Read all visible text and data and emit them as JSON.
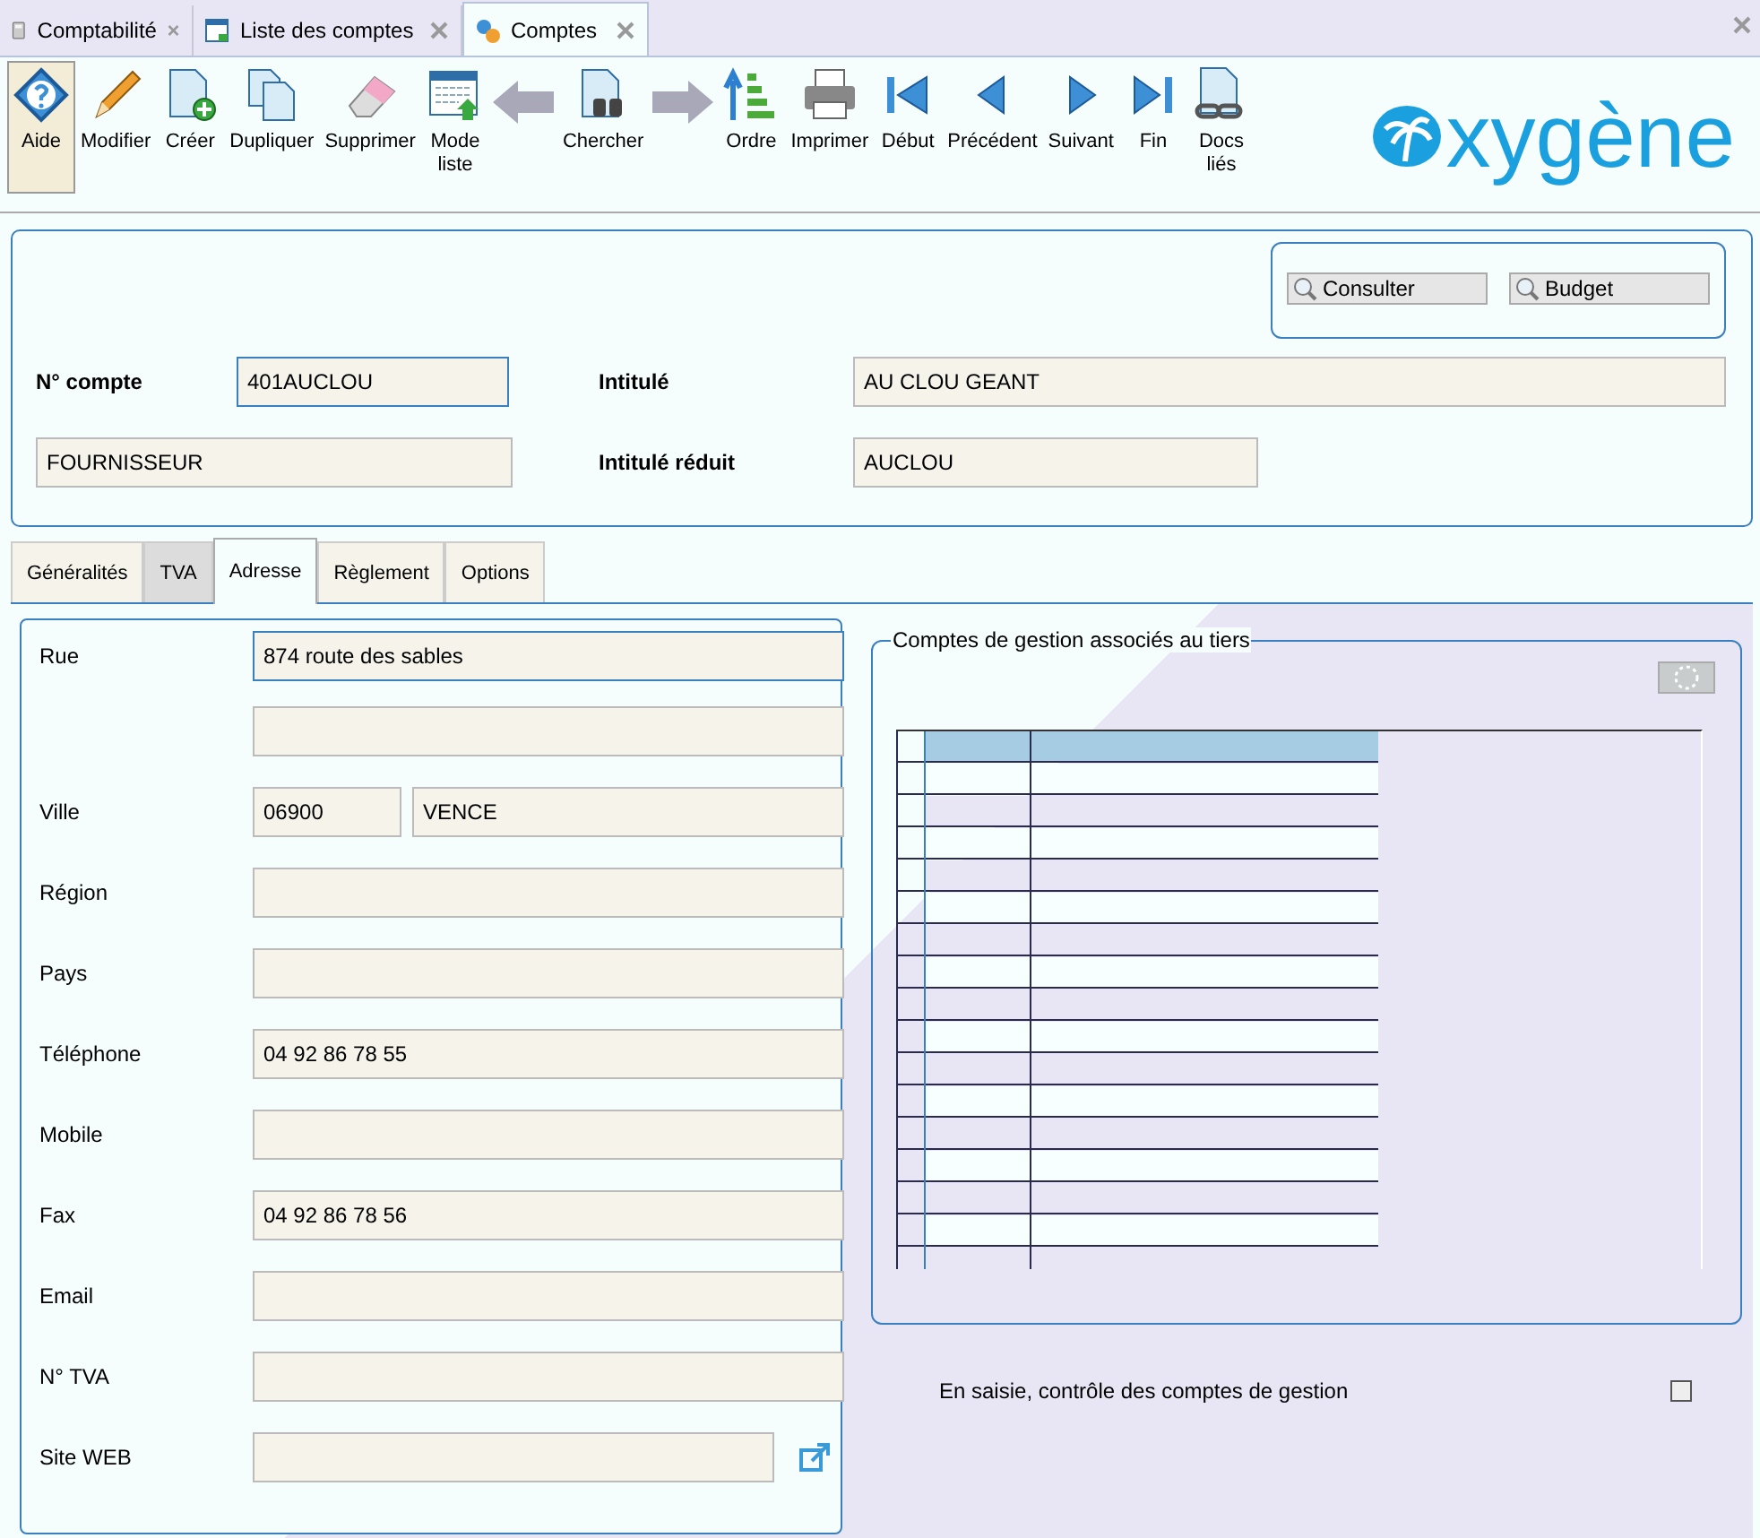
{
  "doc_tabs": [
    {
      "label": "Comptabilité",
      "selected": false
    },
    {
      "label": "Liste des comptes",
      "selected": false
    },
    {
      "label": "Comptes",
      "selected": true
    }
  ],
  "toolbar": [
    {
      "kind": "button",
      "label": "Aide",
      "selected": true
    },
    {
      "kind": "button",
      "label": "Modifier",
      "selected": false
    },
    {
      "kind": "button",
      "label": "Créer",
      "selected": false
    },
    {
      "kind": "button",
      "label": "Dupliquer",
      "selected": false
    },
    {
      "kind": "button",
      "label": "Supprimer",
      "selected": false
    },
    {
      "kind": "button",
      "label": "Mode liste",
      "selected": false
    },
    {
      "kind": "arrow",
      "disabled": true
    },
    {
      "kind": "button",
      "label": "Chercher",
      "selected": false
    },
    {
      "kind": "arrow",
      "disabled": true
    },
    {
      "kind": "button",
      "label": "Ordre",
      "selected": false
    },
    {
      "kind": "button",
      "label": "Imprimer",
      "selected": false
    },
    {
      "kind": "button",
      "label": "Début",
      "selected": false
    },
    {
      "kind": "button",
      "label": "Précédent",
      "selected": false
    },
    {
      "kind": "button",
      "label": "Suivant",
      "selected": false
    },
    {
      "kind": "button",
      "label": "Fin",
      "selected": false
    },
    {
      "kind": "button",
      "label": "Docs liés",
      "selected": false
    }
  ],
  "logo": "xygène",
  "header": {
    "buttons": [
      "Consulter",
      "Budget"
    ],
    "account_label": "N° compte",
    "account": "401AUCLOU",
    "title_label": "Intitulé",
    "title": "AU CLOU GEANT",
    "type": "FOURNISSEUR",
    "short_label": "Intitulé réduit",
    "short": "AUCLOU"
  },
  "tabs": [
    {
      "label": "Généralités",
      "selected": false
    },
    {
      "label": "TVA",
      "selected": false
    },
    {
      "label": "Adresse",
      "selected": true
    },
    {
      "label": "Règlement",
      "selected": false
    },
    {
      "label": "Options",
      "selected": false
    }
  ],
  "address": [
    {
      "kind": "double",
      "label": "Rue",
      "value": "874 route des sables",
      "focused": true
    },
    {
      "kind": "split",
      "label": "Ville",
      "postcode": "06900",
      "value": "VENCE"
    },
    {
      "kind": "single",
      "label": "Région"
    },
    {
      "kind": "single",
      "label": "Pays"
    },
    {
      "kind": "single",
      "label": "Téléphone",
      "value": "04 92 86 78 55"
    },
    {
      "kind": "single",
      "label": "Mobile"
    },
    {
      "kind": "single",
      "label": "Fax",
      "value": "04 92 86 78 56"
    },
    {
      "kind": "single",
      "label": "Email"
    },
    {
      "kind": "single",
      "label": "N° TVA"
    },
    {
      "kind": "link",
      "label": "Site WEB"
    }
  ],
  "accounts_group": {
    "title": "Comptes de gestion associés au tiers"
  },
  "control_check": {
    "label": "En saisie, contrôle des comptes de gestion",
    "checked": false
  }
}
